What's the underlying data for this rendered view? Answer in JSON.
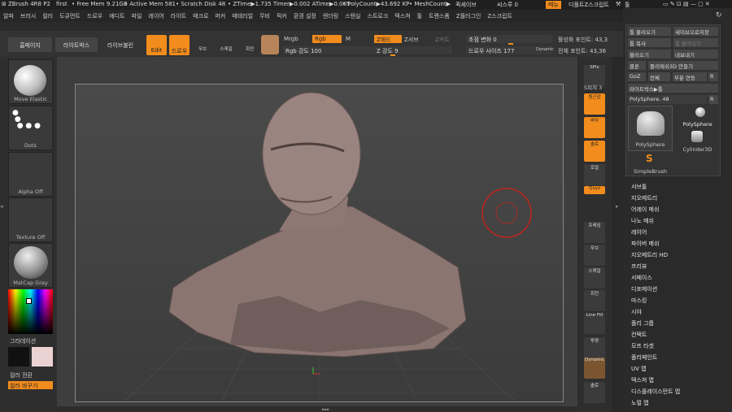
{
  "titlebar": {
    "app": "ZBrush 4R8 P2",
    "project": "first",
    "free_mem": "• Free Mem 9.21GB",
    "active_mem": "• Active Mem 581",
    "scratch": "• Scratch Disk 48",
    "ztime": "• ZTime▶1.735 Timer▶0.002 ATime▶0.005",
    "polycount": "• PolyCount▶43.692 KP",
    "meshcount": "• MeshCount▶",
    "quicksave": "퀵세이브",
    "see_through": "씨스루 0",
    "menus": "메뉴",
    "default_script": "디폴트Z스크립트"
  },
  "menubar": [
    "알파",
    "브러시",
    "컬러",
    "도큐먼트",
    "드로우",
    "에디트",
    "파일",
    "레이어",
    "라이트",
    "매크로",
    "머커",
    "매테리얼",
    "무비",
    "픽커",
    "환경 설정",
    "렌더링",
    "스텐실",
    "스트로크",
    "텍스쳐",
    "툴",
    "트랜스폼",
    "Z플러그인",
    "Z스크립트"
  ],
  "topbar": {
    "homepage": "홈페이지",
    "lightbox": "라이트박스",
    "live_boolean": "라이브불린",
    "edit": "Edit",
    "draw": "드로우",
    "move": "무브",
    "scale": "스케일",
    "rotate": "회전",
    "mrgb": "Mrgb",
    "rgb": "Rgb",
    "m": "M",
    "zadd": "Z애드",
    "zsub": "Z서브",
    "zcut": "Z커트",
    "rgb_intensity": "Rgb 강도 100",
    "z_intensity": "Z 강도 9",
    "focal_shift": "초점 변화 0",
    "draw_size": "드로우 사이즈 177",
    "dynamic": "Dynamic",
    "active_points": "활성화 포인트: 43,3",
    "total_points": "전체 포인트: 43,36"
  },
  "leftshelf": {
    "brush": "Move Elastic",
    "stroke": "Dots",
    "alpha": "Alpha Off",
    "texture": "Texture Off",
    "material": "MatCap Gray",
    "gradient": "그라데이션",
    "switch_color": "컬러 전환",
    "swap_color": "컬러 바꾸기"
  },
  "rightshelf": [
    "SPix",
    "S피쳐 3",
    "원근감",
    "원근법",
    "바닥",
    "솔로",
    "로컬",
    "Qxyz",
    "프레임",
    "무브",
    "스케일",
    "회전",
    "Line Fill",
    "PolyF",
    "투명",
    "고스트",
    "Dynamic",
    "솔로"
  ],
  "tool_panel": {
    "title": "툴",
    "load": "툴 불러오기",
    "save_as": "세이브으로저장",
    "copy": "툴 복사",
    "paste": "툴 붙여넣기",
    "import": "불러오기",
    "export": "내보내기",
    "clone": "클론",
    "make_polymesh": "폴리메쉬3D 만들기",
    "goz": "GoZ",
    "all": "전체",
    "partial": "부분 연동",
    "r": "R",
    "lightbox_tool": "라이트박스▶툴",
    "current_tool": "PolySphere. 48",
    "r2": "R",
    "items": [
      "PolySphere",
      "PolySphere",
      "Cylinder3D",
      "SimpleBrush"
    ]
  },
  "subpalettes": [
    "서브툴",
    "지오메트리",
    "어레이 메쉬",
    "나노 메쉬",
    "레이어",
    "파이버 메쉬",
    "지오메트리 HD",
    "프리뷰",
    "서페이스",
    "디포메이션",
    "마스킹",
    "시야",
    "폴리 그룹",
    "컨택트",
    "모프 타겟",
    "폴리페인트",
    "UV 맵",
    "텍스쳐 맵",
    "디스플레이스먼트 맵",
    "노멀 맵"
  ],
  "colors": {
    "accent": "#f28c1c",
    "primary_color": "#111111",
    "secondary_color": "#ecd3d3"
  }
}
